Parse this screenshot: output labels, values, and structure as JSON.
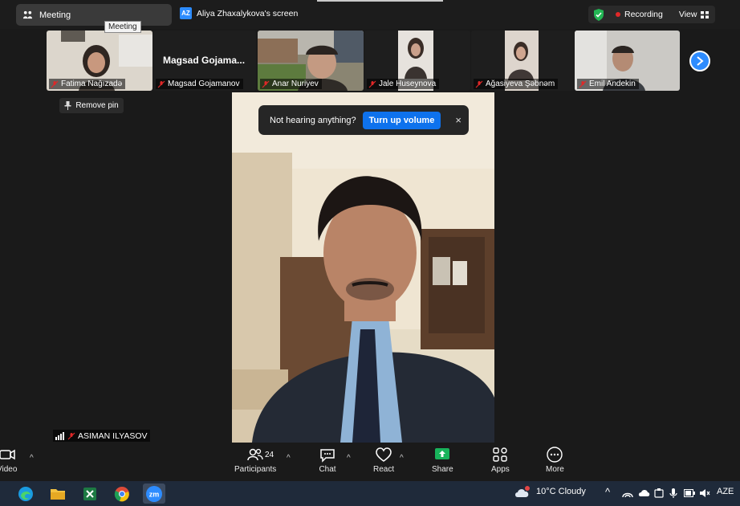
{
  "header": {
    "meeting_tab": "Meeting",
    "tooltip": "Meeting",
    "screen_badge": "AZ",
    "screen_tab": "Aliya Zhaxalykova's screen",
    "recording": "Recording",
    "view": "View"
  },
  "participants_strip": [
    {
      "name": "Fatima Nağızadə",
      "bg": "#d9d4cc"
    },
    {
      "name": "Magsad Gojamanov",
      "display_name": "Magsad  Gojama...",
      "bg": "#1e1e1e"
    },
    {
      "name": "Anar Nuriyev",
      "bg": "#7a7466"
    },
    {
      "name": "Jale Huseynova",
      "bg": "#e4e0dc"
    },
    {
      "name": "Ağasiyeva Şəbnəm",
      "bg": "#d8d0c8"
    },
    {
      "name": "Emil Andekin",
      "bg": "#c9c7c3"
    }
  ],
  "remove_pin": "Remove pin",
  "notice": {
    "text": "Not hearing anything?",
    "button": "Turn up volume",
    "close": "×"
  },
  "active_speaker": "ASIMAN ILYASOV",
  "toolbar": {
    "video": "Video",
    "participants": "Participants",
    "participants_count": "24",
    "chat": "Chat",
    "react": "React",
    "share": "Share",
    "apps": "Apps",
    "more": "More"
  },
  "taskbar": {
    "weather": "10°C  Cloudy",
    "language": "AZE",
    "apps": [
      "edge-icon",
      "file-explorer-icon",
      "excel-icon",
      "chrome-icon",
      "zoom-icon"
    ],
    "zoom_label": "zm"
  },
  "colors": {
    "accent": "#2d8cff",
    "share": "#18b35b",
    "recording": "#e02828"
  }
}
